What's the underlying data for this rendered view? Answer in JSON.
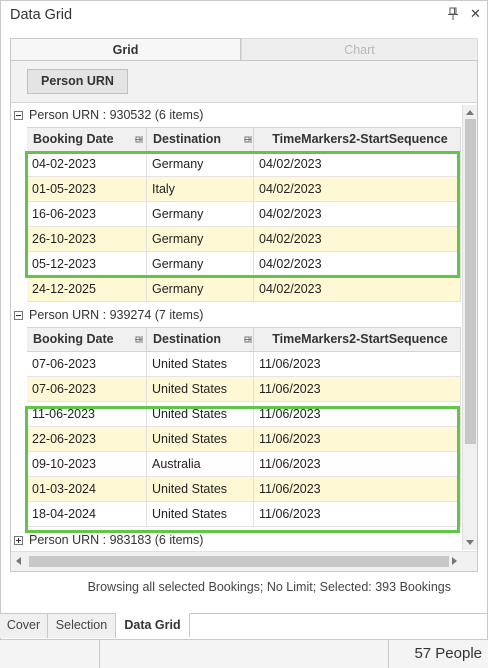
{
  "window": {
    "title": "Data Grid",
    "pin_icon": "pin-icon",
    "close_icon": "close-icon",
    "close_glyph": "✕"
  },
  "top_tabs": [
    {
      "label": "Grid",
      "active": true
    },
    {
      "label": "Chart",
      "active": false
    }
  ],
  "group_panel": {
    "chip_label": "Person URN"
  },
  "columns": [
    "Booking Date",
    "Destination",
    "TimeMarkers2-StartSequence"
  ],
  "groups": [
    {
      "label": "Person URN : 930532 (6 items)",
      "expanded": true,
      "rows": [
        [
          "04-02-2023",
          "Germany",
          "04/02/2023"
        ],
        [
          "01-05-2023",
          "Italy",
          "04/02/2023"
        ],
        [
          "16-06-2023",
          "Germany",
          "04/02/2023"
        ],
        [
          "26-10-2023",
          "Germany",
          "04/02/2023"
        ],
        [
          "05-12-2023",
          "Germany",
          "04/02/2023"
        ],
        [
          "24-12-2025",
          "Germany",
          "04/02/2023"
        ]
      ]
    },
    {
      "label": "Person URN : 939274 (7 items)",
      "expanded": true,
      "rows": [
        [
          "07-06-2023",
          "United States",
          "11/06/2023"
        ],
        [
          "07-06-2023",
          "United States",
          "11/06/2023"
        ],
        [
          "11-06-2023",
          "United States",
          "11/06/2023"
        ],
        [
          "22-06-2023",
          "United States",
          "11/06/2023"
        ],
        [
          "09-10-2023",
          "Australia",
          "11/06/2023"
        ],
        [
          "01-03-2024",
          "United States",
          "11/06/2023"
        ],
        [
          "18-04-2024",
          "United States",
          "11/06/2023"
        ]
      ]
    },
    {
      "label": "Person URN : 983183 (6 items)",
      "expanded": false,
      "rows": []
    }
  ],
  "status_text": "Browsing all selected Bookings; No Limit; Selected: 393 Bookings",
  "bottom_tabs": [
    {
      "label": "Cover",
      "active": false
    },
    {
      "label": "Selection",
      "active": false
    },
    {
      "label": "Data Grid",
      "active": true
    }
  ],
  "statusbar": {
    "people_count": "57 People"
  },
  "colors": {
    "highlight": "#64c449",
    "alt_row": "#fff8d5",
    "header_bg": "#f0f0f0"
  }
}
